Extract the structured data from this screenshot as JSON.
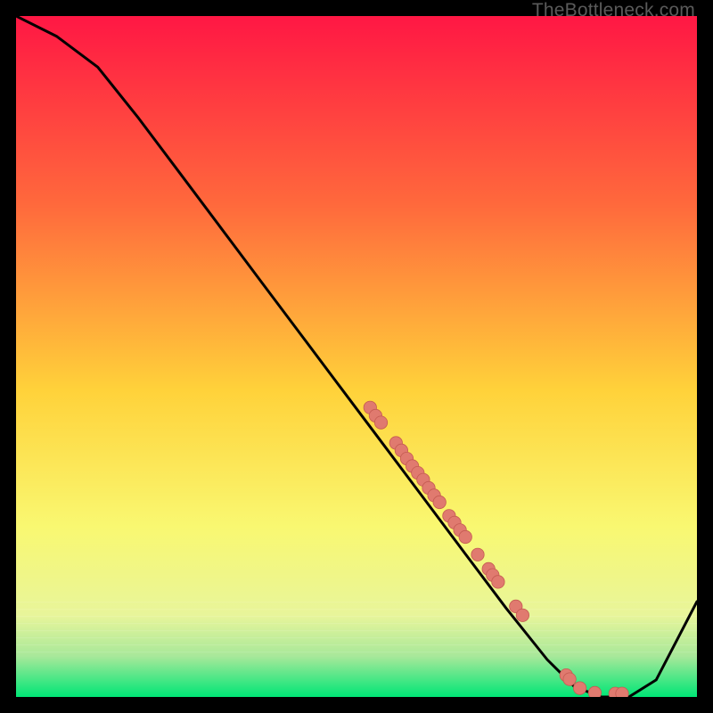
{
  "watermark": "TheBottleneck.com",
  "colors": {
    "black": "#000000",
    "line": "#000000",
    "marker_fill": "#e07a6f",
    "marker_stroke": "#c55b52",
    "grad_top": "#ff1744",
    "grad_mid1": "#ff6a3c",
    "grad_mid2": "#ffd23a",
    "grad_low1": "#f9f871",
    "grad_low2": "#a8e89a",
    "grad_bottom": "#00e676"
  },
  "chart_data": {
    "type": "line",
    "title": "",
    "xlabel": "",
    "ylabel": "",
    "xlim": [
      0,
      100
    ],
    "ylim": [
      0,
      100
    ],
    "series": [
      {
        "name": "curve",
        "x": [
          0,
          6,
          12,
          18,
          24,
          30,
          36,
          42,
          48,
          54,
          60,
          66,
          72,
          78,
          82,
          86,
          90,
          94,
          100
        ],
        "y": [
          100,
          97,
          92.5,
          85,
          77,
          69,
          61,
          53,
          45,
          37,
          29,
          21,
          13,
          5.5,
          1.5,
          0,
          0,
          2.5,
          14
        ]
      }
    ],
    "markers": [
      {
        "x": 52.0,
        "y": 42.5
      },
      {
        "x": 52.8,
        "y": 41.3
      },
      {
        "x": 53.6,
        "y": 40.3
      },
      {
        "x": 55.8,
        "y": 37.3
      },
      {
        "x": 56.6,
        "y": 36.2
      },
      {
        "x": 57.4,
        "y": 35.0
      },
      {
        "x": 58.2,
        "y": 33.9
      },
      {
        "x": 59.0,
        "y": 32.9
      },
      {
        "x": 59.8,
        "y": 31.9
      },
      {
        "x": 60.6,
        "y": 30.7
      },
      {
        "x": 61.4,
        "y": 29.6
      },
      {
        "x": 62.2,
        "y": 28.6
      },
      {
        "x": 63.6,
        "y": 26.6
      },
      {
        "x": 64.4,
        "y": 25.6
      },
      {
        "x": 65.2,
        "y": 24.5
      },
      {
        "x": 66.0,
        "y": 23.5
      },
      {
        "x": 67.8,
        "y": 20.9
      },
      {
        "x": 69.4,
        "y": 18.8
      },
      {
        "x": 70.0,
        "y": 17.9
      },
      {
        "x": 70.8,
        "y": 16.9
      },
      {
        "x": 73.4,
        "y": 13.3
      },
      {
        "x": 74.4,
        "y": 12.0
      },
      {
        "x": 80.8,
        "y": 3.2
      },
      {
        "x": 81.3,
        "y": 2.6
      },
      {
        "x": 82.8,
        "y": 1.3
      },
      {
        "x": 85.0,
        "y": 0.6
      },
      {
        "x": 88.0,
        "y": 0.5
      },
      {
        "x": 89.0,
        "y": 0.5
      }
    ]
  }
}
